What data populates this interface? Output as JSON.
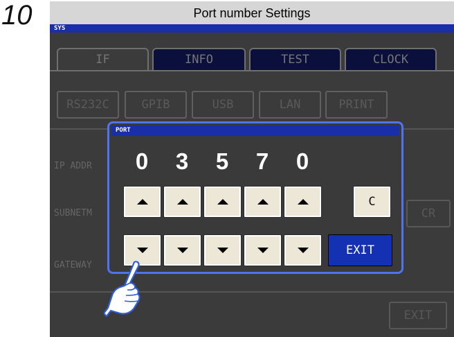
{
  "step": "10",
  "caption": "Port number Settings",
  "screen": {
    "sys_label": "SYS",
    "tabs": [
      {
        "label": "IF",
        "active": true
      },
      {
        "label": "INFO",
        "active": false
      },
      {
        "label": "TEST",
        "active": false
      },
      {
        "label": "CLOCK",
        "active": false
      }
    ],
    "interfaces": [
      "RS232C",
      "GPIB",
      "USB",
      "LAN",
      "PRINT"
    ],
    "fields": {
      "ip": "IP ADDR",
      "subnet": "SUBNETM",
      "gateway": "GATEWAY"
    },
    "cr_label": "CR",
    "exit_label": "EXIT"
  },
  "dialog": {
    "title": "PORT",
    "digits": [
      "0",
      "3",
      "5",
      "7",
      "0"
    ],
    "clear_label": "C",
    "exit_label": "EXIT"
  },
  "icons": {
    "up": "arrow-up-icon",
    "down": "arrow-down-icon",
    "pointer": "pointing-hand-icon"
  },
  "colors": {
    "title_bar": "#1a2ea8",
    "dialog_border": "#4f74ee",
    "key_face": "#ede7d7",
    "exit_key": "#1531b3"
  }
}
